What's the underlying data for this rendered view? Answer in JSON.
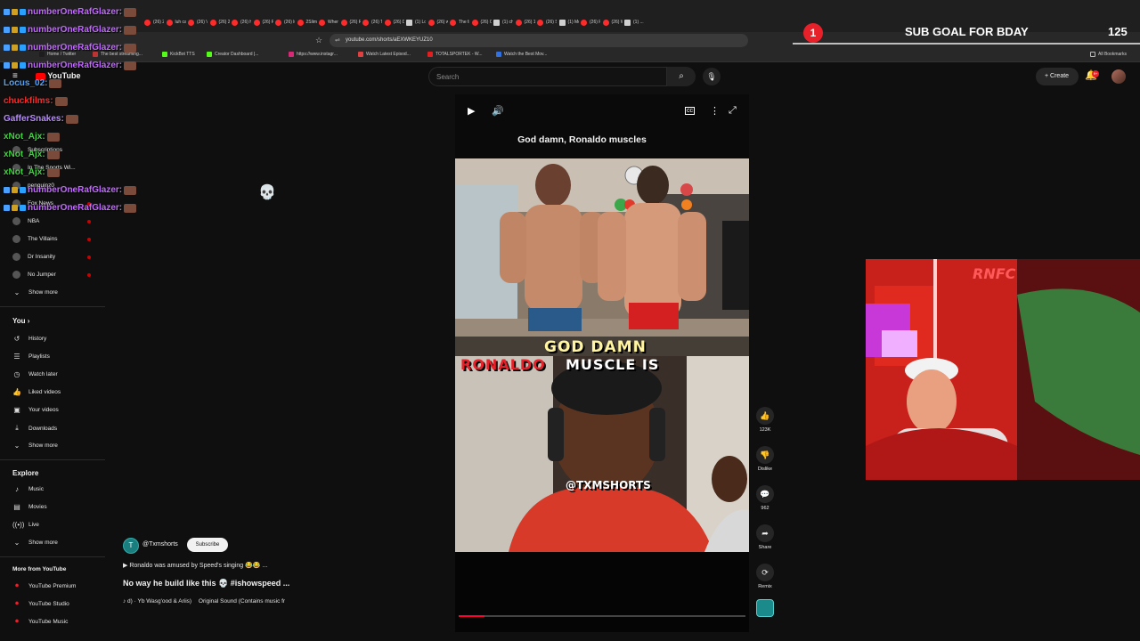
{
  "browser": {
    "tabs": [
      "(26) 25...",
      "luh calm...",
      "(26) VRI...",
      "(26) 25li...",
      "(26) HUI...",
      "(26) Pop...",
      "(26) luh...",
      "2Slimey",
      "Where t...",
      "(26) Real...",
      "(26) THE...",
      "(26) Don...",
      "(1) Lon t...",
      "(26) wild...",
      "The fam...",
      "(26) Clip...",
      "(1) chan...",
      "(26) 1on...",
      "(26) Spe...",
      "(1) Mo...",
      "(26) Pu...",
      "(26) W...",
      "(1) ..."
    ],
    "url": "youtube.com/shorts/aEXWKEYUZ10",
    "bookmarks": [
      {
        "label": "Home / Twitter",
        "color": "#1d1d1d"
      },
      {
        "label": "The best streaming...",
        "color": "#bb3333"
      },
      {
        "label": "KickBot TTS",
        "color": "#53fc18"
      },
      {
        "label": "Creator Dashboard |...",
        "color": "#53fc18"
      },
      {
        "label": "https://www.instagr...",
        "color": "#d62976"
      },
      {
        "label": "Watch Latest Episod...",
        "color": "#e04040"
      },
      {
        "label": "TOTALSPORTEK - W...",
        "color": "#e02020"
      },
      {
        "label": "Watch the Best Mov...",
        "color": "#3070e0"
      }
    ],
    "all_bookmarks": "All Bookmarks"
  },
  "overlay": {
    "sub_goal_badge": "1",
    "sub_goal_text": "SUB GOAL FOR BDAY",
    "sub_goal_count": "125"
  },
  "chat": [
    {
      "user": "numberOneRafGlazer:",
      "color": "#c26aff"
    },
    {
      "user": "numberOneRafGlazer:",
      "color": "#c26aff"
    },
    {
      "user": "numberOneRafGlazer:",
      "color": "#c26aff"
    },
    {
      "user": "numberOneRafGlazer:",
      "color": "#c26aff"
    },
    {
      "user": "Locus_02:",
      "color": "#4fa3ff"
    },
    {
      "user": "chuckfilms:",
      "color": "#ff2a2a"
    },
    {
      "user": "GafferSnakes:",
      "color": "#b88cff"
    },
    {
      "user": "xNot_Ajx:",
      "color": "#3bd63b"
    },
    {
      "user": "xNot_Ajx:",
      "color": "#3bd63b"
    },
    {
      "user": "xNot_Ajx:",
      "color": "#3bd63b"
    },
    {
      "user": "numberOneRafGlazer:",
      "color": "#c26aff"
    },
    {
      "user": "numberOneRafGlazer:",
      "color": "#c26aff"
    }
  ],
  "header": {
    "logo": "YouTube",
    "search_placeholder": "Search",
    "create_label": "Create",
    "notif_count": "9+"
  },
  "sidebar": {
    "subscriptions": [
      "Subscriptions",
      "In The Sports Wi...",
      "penguinz0",
      "Fox News",
      "NBA",
      "The Villains",
      "Dr Insanity",
      "No Jumper"
    ],
    "show_more": "Show more",
    "you_label": "You",
    "you_items": [
      {
        "label": "History",
        "icon": "history-icon"
      },
      {
        "label": "Playlists",
        "icon": "playlists-icon"
      },
      {
        "label": "Watch later",
        "icon": "clock-icon"
      },
      {
        "label": "Liked videos",
        "icon": "thumbs-up-icon"
      },
      {
        "label": "Your videos",
        "icon": "video-icon"
      },
      {
        "label": "Downloads",
        "icon": "download-icon"
      }
    ],
    "explore_label": "Explore",
    "explore_items": [
      {
        "label": "Music",
        "icon": "music-icon"
      },
      {
        "label": "Movies",
        "icon": "movies-icon"
      },
      {
        "label": "Live",
        "icon": "live-icon"
      }
    ],
    "more_label": "More from YouTube",
    "more_items": [
      "YouTube Premium",
      "YouTube Studio",
      "YouTube Music"
    ]
  },
  "short": {
    "caption": "God damn, Ronaldo muscles",
    "overlay_line1": "GOD DAMN",
    "overlay_line2_red": "RONALDO",
    "overlay_line2_white": "MUSCLE IS",
    "watermark": "@TXMSHORTS",
    "progress": 0.09
  },
  "actions": {
    "likes": "123K",
    "dislike": "Dislike",
    "comments": "962",
    "share": "Share",
    "remix": "Remix"
  },
  "channel": {
    "name": "@Txmshorts",
    "subscribe": "Subscribe",
    "related": "▶ Ronaldo was amused by Speed's singing 😂😂 ...",
    "title": "No way he build like this 💀 #ishowspeed ...",
    "audio_artist": "♪ d) · Yb Wasg'ood & Ariis)",
    "audio_track": "Original Sound (Contains music fr"
  },
  "webcam": {
    "sign": "RNFC"
  }
}
